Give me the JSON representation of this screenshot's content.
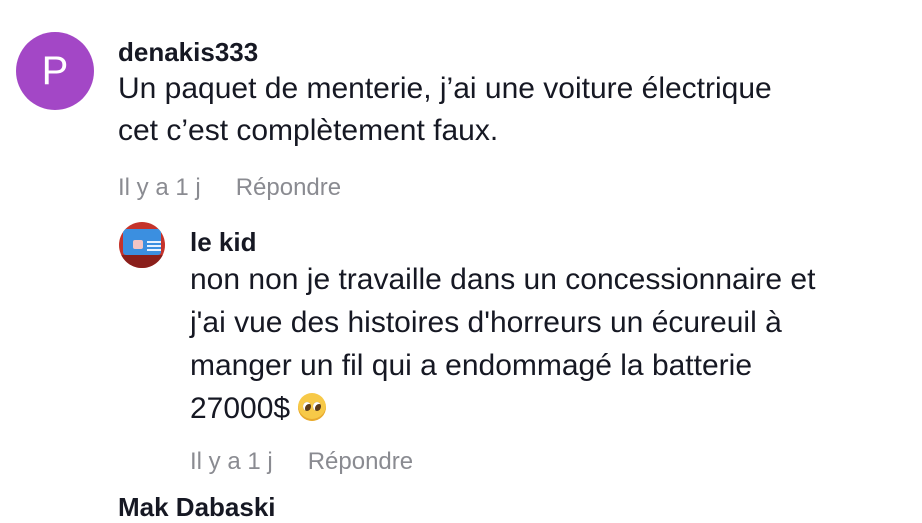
{
  "comments": [
    {
      "avatar_letter": "P",
      "avatar_color": "#a347c6",
      "username": "denakis333",
      "text": "Un paquet de menterie, j’ai une voiture électrique\ncet c’est complètement faux.",
      "time": "Il y a 1 j",
      "reply_label": "Répondre"
    },
    {
      "avatar_icon": "profile-photo",
      "username": "le kid",
      "text": "non non je travaille dans un concessionnaire et\nj'ai vue des histoires d'horreurs un écureuil à\nmanger un fil qui a endommagé la batterie\n27000$",
      "emoji_icon": "pleading-face-emoji-icon",
      "time": "Il y a 1 j",
      "reply_label": "Répondre"
    }
  ],
  "next_comment": {
    "username": "Mak Dabaski"
  }
}
